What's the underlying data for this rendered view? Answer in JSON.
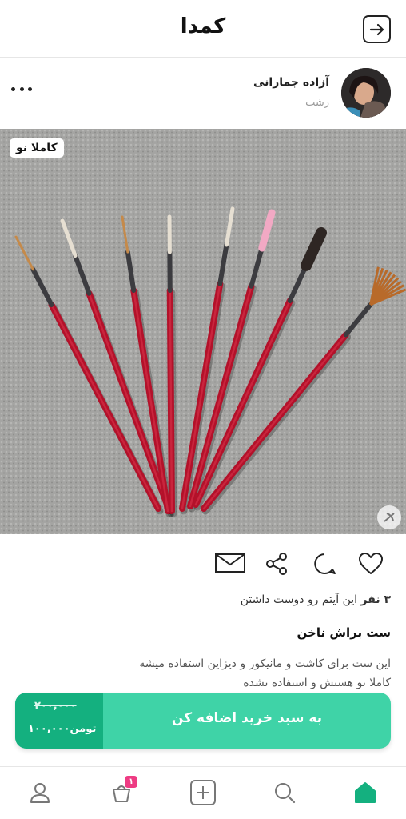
{
  "header": {
    "app_name": "کمدا",
    "back_icon": "arrow-right-icon"
  },
  "seller": {
    "name": "آزاده جمارانی",
    "city": "رشت",
    "more_icon": "more-dots-icon"
  },
  "product": {
    "badge": "کاملا نو",
    "likes_count": "۳ نفر",
    "likes_text": " این آیتم رو دوست داشتن",
    "title": "ست براش ناخن",
    "description_line1": "این ست برای کاشت و مانیکور و دیزاین استفاده میشه",
    "description_line2": "کاملا نو هستش و استفاده نشده"
  },
  "actions": [
    "heart-icon",
    "comment-icon",
    "share-icon",
    "message-icon"
  ],
  "cart": {
    "old_price": "۲۰۰,۰۰۰",
    "new_price": "۱۰۰,۰۰۰",
    "currency": "تومن",
    "button_label": "به سبد خرید اضافه کن"
  },
  "bottom_nav": {
    "items": [
      "home-icon",
      "search-icon",
      "add-icon",
      "cart-icon",
      "profile-icon"
    ],
    "cart_badge": "۱",
    "active": "home-icon"
  },
  "colors": {
    "accent": "#3fd3a7",
    "accent_dark": "#14b07f",
    "badge": "#ee3b83"
  }
}
